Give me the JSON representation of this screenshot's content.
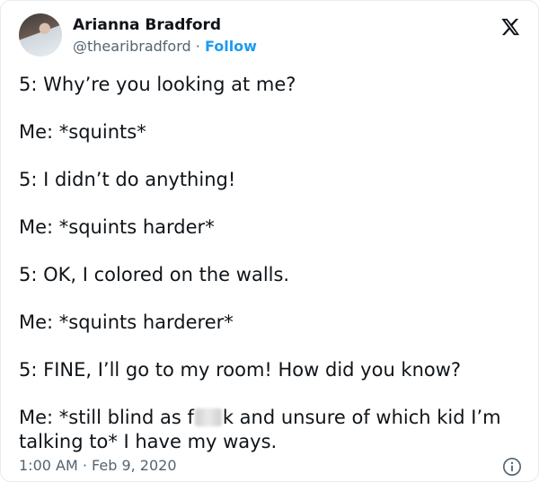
{
  "author": {
    "name": "Arianna Bradford",
    "handle": "@thearibradford",
    "separator": "·",
    "follow_label": "Follow"
  },
  "platform_icon": "x-logo-icon",
  "lines": [
    "5: Why’re you looking at me?",
    "Me: *squints*",
    "5: I didn’t do anything!",
    "Me: *squints harder*",
    "5: OK, I colored on the walls.",
    "Me: *squints harderer*",
    "5: FINE, I’ll go to my room! How did you know?"
  ],
  "last_line": {
    "before_blur": "Me: *still blind as f",
    "after_blur": "k and unsure of which kid I’m talking to* I have my ways."
  },
  "footer": {
    "timestamp": "1:00 AM · Feb 9, 2020"
  },
  "colors": {
    "text": "#0f1419",
    "secondary": "#536471",
    "accent": "#1d9bf0"
  }
}
